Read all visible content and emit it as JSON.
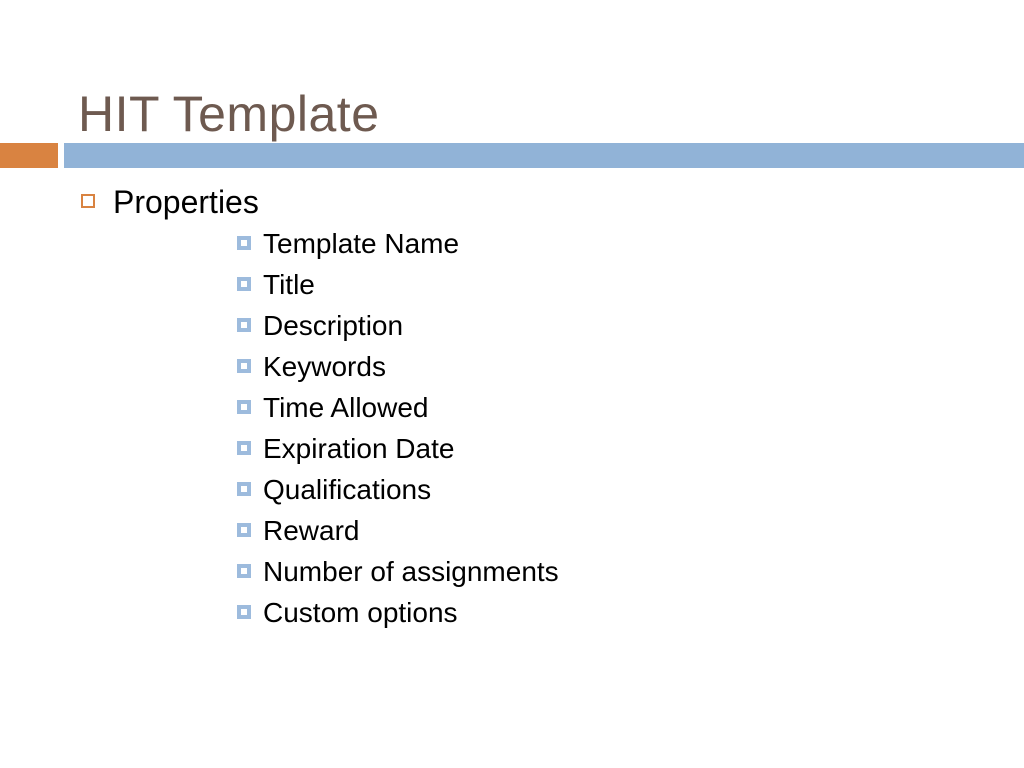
{
  "slide": {
    "title": "HIT Template",
    "colors": {
      "title_text": "#6E5A50",
      "accent_bar": "#D98341",
      "main_bar": "#91B3D7",
      "level1_bullet": "#D98341",
      "level2_bullet": "#9DBBDD",
      "body_text": "#000000",
      "background": "#FFFFFF"
    },
    "body": {
      "level1": [
        {
          "label": "Properties",
          "bullet": "hollow-orange-square-bullet",
          "children": [
            {
              "label": "Template Name",
              "bullet": "blue-square-bullet"
            },
            {
              "label": "Title",
              "bullet": "blue-square-bullet"
            },
            {
              "label": "Description",
              "bullet": "blue-square-bullet"
            },
            {
              "label": "Keywords",
              "bullet": "blue-square-bullet"
            },
            {
              "label": "Time Allowed",
              "bullet": "blue-square-bullet"
            },
            {
              "label": "Expiration Date",
              "bullet": "blue-square-bullet"
            },
            {
              "label": "Qualifications",
              "bullet": "blue-square-bullet"
            },
            {
              "label": "Reward",
              "bullet": "blue-square-bullet"
            },
            {
              "label": "Number of assignments",
              "bullet": "blue-square-bullet"
            },
            {
              "label": "Custom options",
              "bullet": "blue-square-bullet"
            }
          ]
        }
      ]
    }
  }
}
